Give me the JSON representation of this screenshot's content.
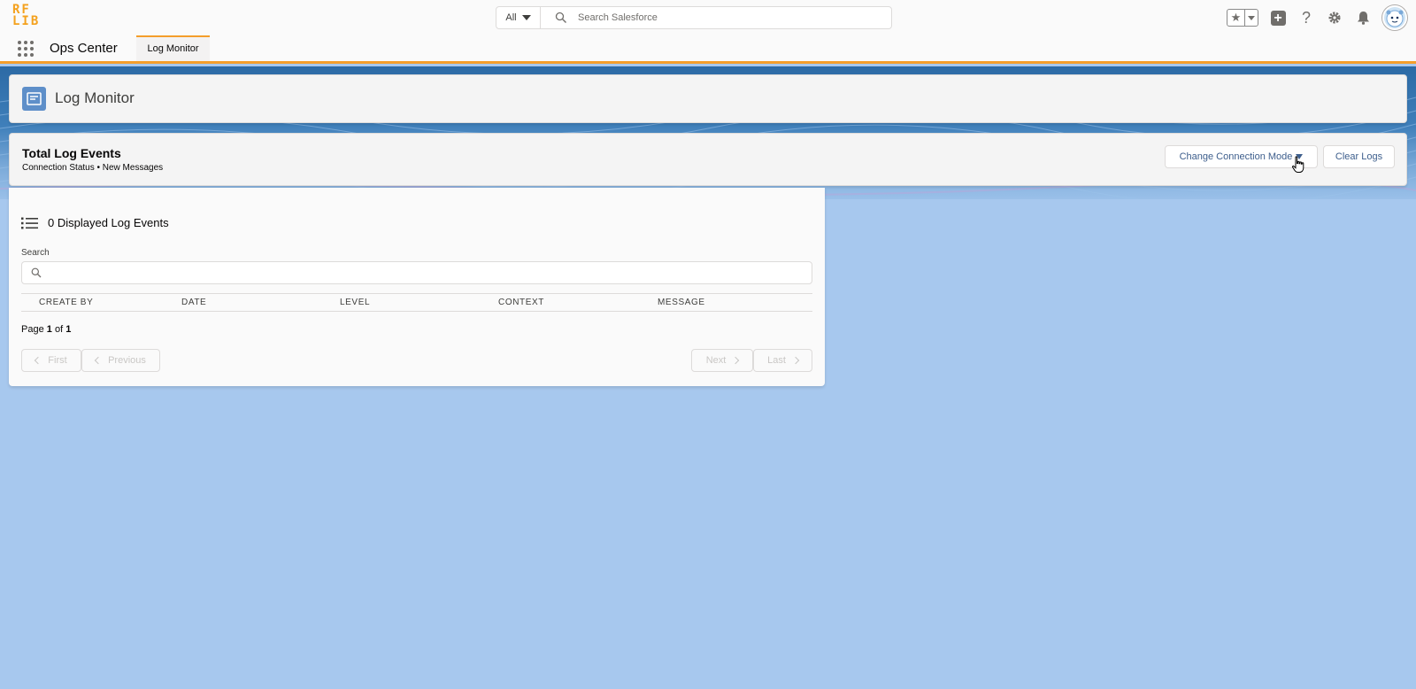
{
  "header": {
    "logo_top": "RF",
    "logo_bottom": "LIB",
    "search_scope": "All",
    "search_placeholder": "Search Salesforce"
  },
  "nav": {
    "app_name": "Ops Center",
    "tab_label": "Log Monitor"
  },
  "page_header": {
    "title": "Log Monitor"
  },
  "events_card": {
    "title": "Total Log Events",
    "subtitle": "Connection Status • New Messages",
    "change_connection_label": "Change Connection Mode",
    "clear_logs_label": "Clear Logs"
  },
  "list": {
    "title": "0 Displayed Log Events",
    "search_label": "Search",
    "columns": [
      "CREATE BY",
      "DATE",
      "LEVEL",
      "CONTEXT",
      "MESSAGE"
    ],
    "page_prefix": "Page",
    "page_current": "1",
    "page_of": "of",
    "page_total": "1",
    "first_label": "First",
    "previous_label": "Previous",
    "next_label": "Next",
    "last_label": "Last"
  },
  "colors": {
    "brand_orange": "#f49e2b",
    "page_background": "#a7c8ee",
    "page_icon": "#5e8fc9",
    "button_text": "#3d5e8c"
  }
}
